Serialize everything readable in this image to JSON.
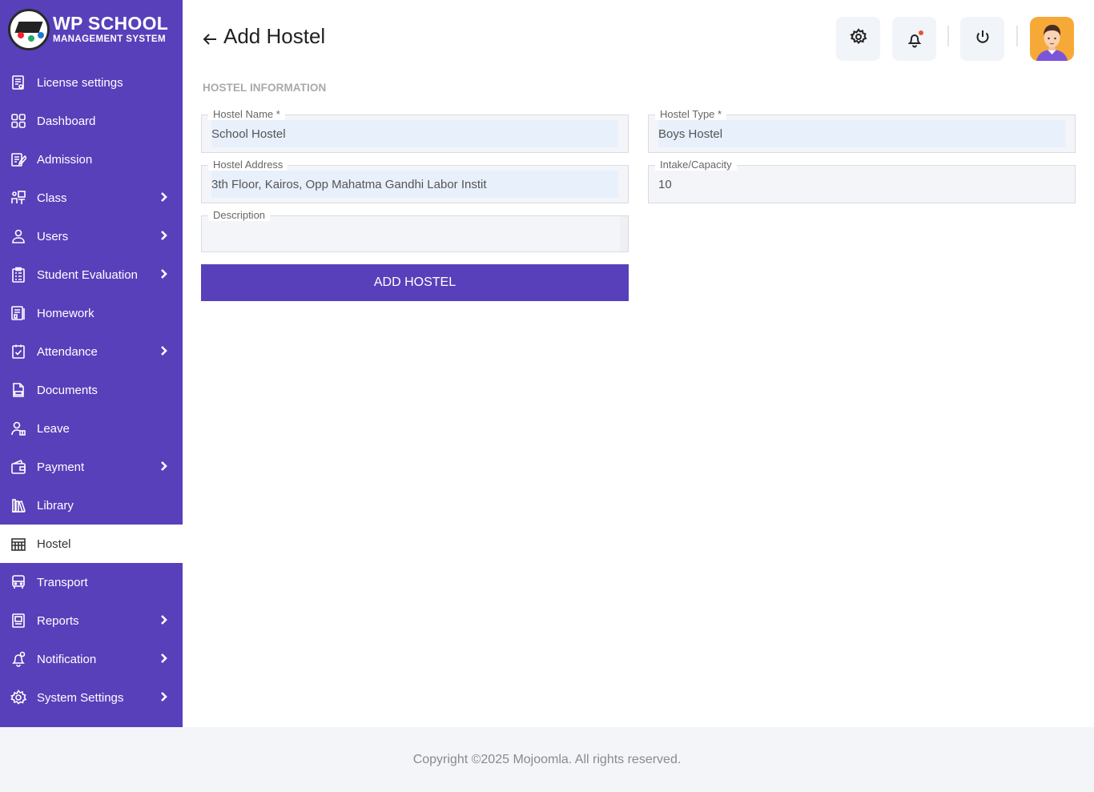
{
  "brand": {
    "title": "WP SCHOOL",
    "subtitle": "MANAGEMENT SYSTEM",
    "accent": "#5840bb"
  },
  "sidebar": {
    "items": [
      {
        "label": "License settings",
        "icon": "license-icon",
        "has_submenu": false
      },
      {
        "label": "Dashboard",
        "icon": "grid-icon",
        "has_submenu": false
      },
      {
        "label": "Admission",
        "icon": "admission-icon",
        "has_submenu": false
      },
      {
        "label": "Class",
        "icon": "class-icon",
        "has_submenu": true
      },
      {
        "label": "Users",
        "icon": "user-icon",
        "has_submenu": true
      },
      {
        "label": "Student Evaluation",
        "icon": "evaluation-icon",
        "has_submenu": true
      },
      {
        "label": "Homework",
        "icon": "homework-icon",
        "has_submenu": false
      },
      {
        "label": "Attendance",
        "icon": "attendance-icon",
        "has_submenu": true
      },
      {
        "label": "Documents",
        "icon": "document-icon",
        "has_submenu": false
      },
      {
        "label": "Leave",
        "icon": "leave-icon",
        "has_submenu": false
      },
      {
        "label": "Payment",
        "icon": "wallet-icon",
        "has_submenu": true
      },
      {
        "label": "Library",
        "icon": "library-icon",
        "has_submenu": false
      },
      {
        "label": "Hostel",
        "icon": "hostel-icon",
        "has_submenu": false,
        "active": true
      },
      {
        "label": "Transport",
        "icon": "bus-icon",
        "has_submenu": false
      },
      {
        "label": "Reports",
        "icon": "report-icon",
        "has_submenu": true
      },
      {
        "label": "Notification",
        "icon": "bell-icon",
        "has_submenu": true
      },
      {
        "label": "System Settings",
        "icon": "gear-icon",
        "has_submenu": true
      }
    ]
  },
  "header": {
    "title": "Add Hostel"
  },
  "form": {
    "section_title": "HOSTEL INFORMATION",
    "hostel_name": {
      "label": "Hostel Name *",
      "value": "School Hostel"
    },
    "hostel_type": {
      "label": "Hostel Type *",
      "value": "Boys Hostel"
    },
    "hostel_address": {
      "label": "Hostel Address",
      "value": "3th Floor, Kairos, Opp Mahatma Gandhi Labor Instit"
    },
    "capacity": {
      "label": "Intake/Capacity",
      "value": "10"
    },
    "description": {
      "label": "Description",
      "value": ""
    },
    "submit_label": "ADD HOSTEL"
  },
  "footer": {
    "copyright": "Copyright ©2025 Mojoomla. All rights reserved."
  }
}
